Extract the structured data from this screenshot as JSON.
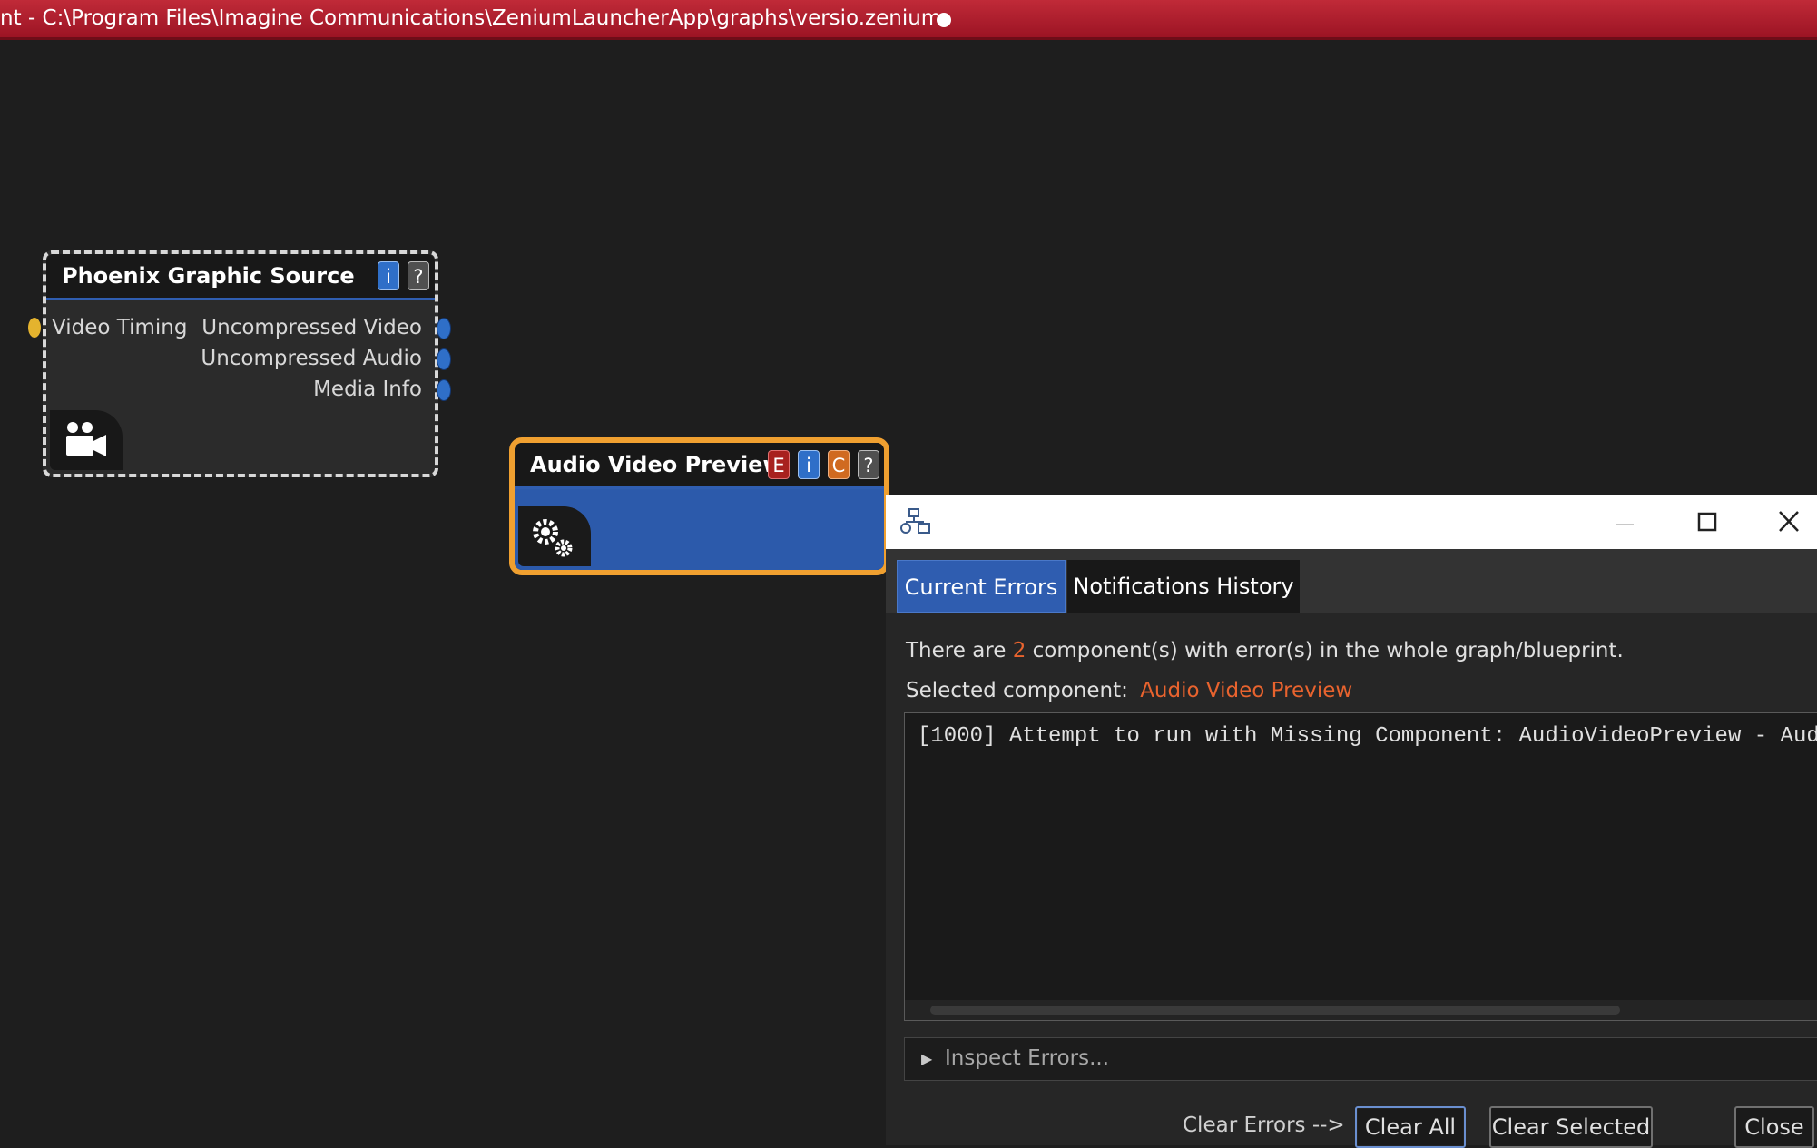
{
  "window": {
    "title": "nt - C:\\Program Files\\Imagine Communications\\ZeniumLauncherApp\\graphs\\versio.zenium",
    "titlebar_color": "#b01e2e"
  },
  "nodes": {
    "phoenix": {
      "title": "Phoenix Graphic Source",
      "badges": {
        "info": "i",
        "help": "?"
      },
      "inputs": [
        "Video Timing"
      ],
      "outputs": [
        "Uncompressed Video",
        "Uncompressed Audio",
        "Media Info"
      ],
      "icon": "camera-icon"
    },
    "avp": {
      "title": "Audio Video Preview",
      "badges": {
        "error": "E",
        "info": "i",
        "config": "C",
        "help": "?"
      },
      "icon": "gears-icon",
      "highlight_color": "#f0a030"
    }
  },
  "dialog": {
    "icon": "graph-icon",
    "tabs": [
      "Current Errors",
      "Notifications History"
    ],
    "summary": {
      "prefix": "There are",
      "count": "2",
      "suffix": "component(s) with error(s) in the whole graph/blueprint."
    },
    "selected": {
      "label": "Selected component:",
      "value": "Audio Video Preview"
    },
    "log_line": "[1000] Attempt to run with Missing Component: AudioVideoPreview - Aud",
    "inspect_label": "Inspect Errors...",
    "clear_label": "Clear Errors -->",
    "buttons": {
      "clear_all": "Clear All",
      "clear_selected": "Clear Selected",
      "close": "Close"
    },
    "accent_color": "#e8632e",
    "tab_active_color": "#2f5db0"
  }
}
